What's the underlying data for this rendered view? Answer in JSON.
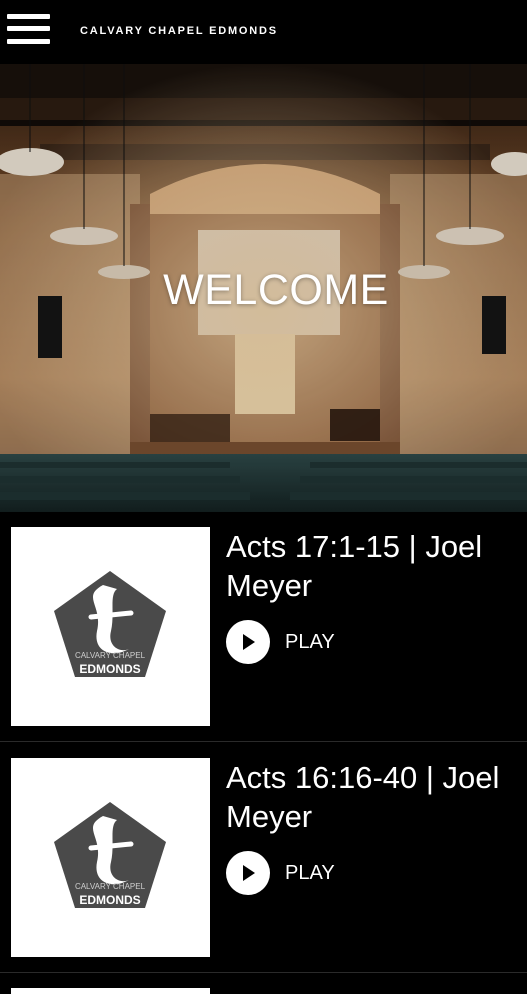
{
  "header": {
    "menu_icon": "hamburger-menu-icon",
    "brand": "CALVARY CHAPEL EDMONDS"
  },
  "hero": {
    "title": "WELCOME"
  },
  "sermons": [
    {
      "title": "Acts 17:1-15 | Joel Meyer",
      "play_label": "PLAY",
      "logo_top": "CALVARY CHAPEL",
      "logo_bottom": "EDMONDS",
      "logo_letter": "t"
    },
    {
      "title": "Acts 16:16-40 | Joel Meyer",
      "play_label": "PLAY",
      "logo_top": "CALVARY CHAPEL",
      "logo_bottom": "EDMONDS",
      "logo_letter": "t"
    }
  ]
}
